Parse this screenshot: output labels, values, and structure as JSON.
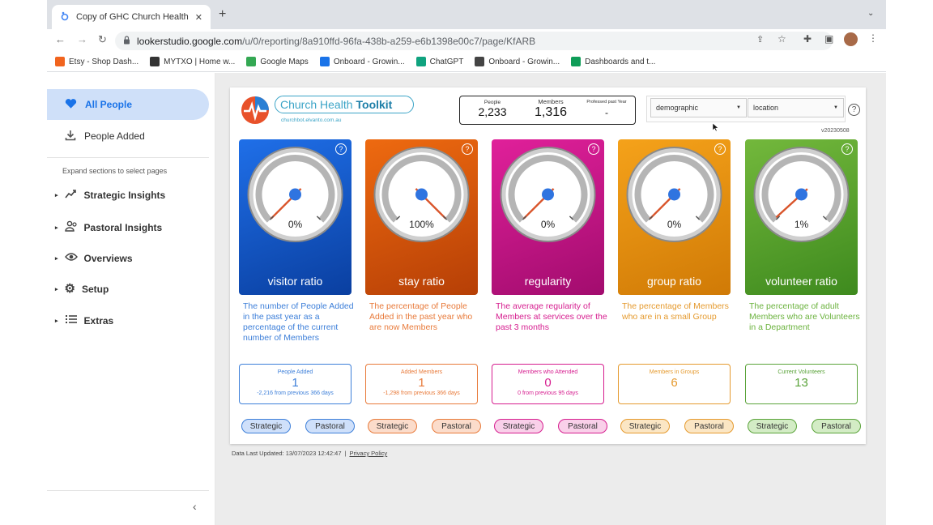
{
  "browser": {
    "tab_title": "Copy of GHC Church Health To",
    "url_host": "lookerstudio.google.com",
    "url_path": "/u/0/reporting/8a910ffd-96fa-438b-a259-e6b1398e00c7/page/KfARB",
    "bookmarks": [
      {
        "label": "Etsy - Shop Dash...",
        "color": "#f1641e"
      },
      {
        "label": "MYTXO | Home w...",
        "color": "#333333"
      },
      {
        "label": "Google Maps",
        "color": "#34a853"
      },
      {
        "label": "Onboard - Growin...",
        "color": "#1a73e8"
      },
      {
        "label": "ChatGPT",
        "color": "#10a37f"
      },
      {
        "label": "Onboard - Growin...",
        "color": "#444444"
      },
      {
        "label": "Dashboards and t...",
        "color": "#0f9d58"
      }
    ]
  },
  "sidebar": {
    "pages": [
      {
        "label": "All People",
        "icon": "heart-icon",
        "active": true
      },
      {
        "label": "People Added",
        "icon": "download-icon",
        "active": false
      }
    ],
    "hint": "Expand sections to select pages",
    "groups": [
      {
        "label": "Strategic Insights",
        "icon": "trend-icon"
      },
      {
        "label": "Pastoral Insights",
        "icon": "people-icon"
      },
      {
        "label": "Overviews",
        "icon": "eye-icon"
      },
      {
        "label": "Setup",
        "icon": "gear-icon"
      },
      {
        "label": "Extras",
        "icon": "list-icon"
      }
    ]
  },
  "header": {
    "brand_text": "Church Health",
    "brand_bold": "Toolkit",
    "brand_url": "churchbot.elvanto.com.au",
    "stats": [
      {
        "label": "People",
        "value": "2,233"
      },
      {
        "label": "Members",
        "value": "1,316"
      },
      {
        "label": "Professed past Year",
        "value": "-"
      }
    ],
    "filter_demographic": "demographic",
    "filter_location": "location",
    "version": "v20230508"
  },
  "cards": [
    {
      "label": "visitor ratio",
      "percent": "0%",
      "gauge_fraction": 0.0,
      "color_top": "#1f6fe8",
      "color_bottom": "#0a3fa0",
      "desc": "The number of People Added in the past year as a percentage of the current number of Members",
      "desc_color": "#3d7fd9",
      "metric_title": "People Added",
      "metric_value": "1",
      "metric_delta": "-2,216 from previous 366 days",
      "accent": "#3d7fd9",
      "pill_bg": "#cfe0fa"
    },
    {
      "label": "stay ratio",
      "percent": "100%",
      "gauge_fraction": 1.0,
      "color_top": "#ee6a10",
      "color_bottom": "#b63f06",
      "desc": "The percentage of People Added in the past year who are now Members",
      "desc_color": "#e87a3a",
      "metric_title": "Added Members",
      "metric_value": "1",
      "metric_delta": "-1,298 from previous 366 days",
      "accent": "#e87a3a",
      "pill_bg": "#fbdccb"
    },
    {
      "label": "regularity",
      "percent": "0%",
      "gauge_fraction": 0.0,
      "color_top": "#e0209a",
      "color_bottom": "#a20c6e",
      "desc": "The average regularity of Members at services over the past 3 months",
      "desc_color": "#d61d8f",
      "metric_title": "Members who Attended",
      "metric_value": "0",
      "metric_delta": "0 from previous 95 days",
      "accent": "#d61d8f",
      "pill_bg": "#f9d0e9"
    },
    {
      "label": "group ratio",
      "percent": "0%",
      "gauge_fraction": 0.0,
      "color_top": "#f5a21a",
      "color_bottom": "#d07a06",
      "desc": "The percentage of Members who are in a small Group",
      "desc_color": "#e59a2e",
      "metric_title": "Members in Groups",
      "metric_value": "6",
      "metric_delta": "",
      "accent": "#e59a2e",
      "pill_bg": "#fbe6c4"
    },
    {
      "label": "volunteer ratio",
      "percent": "1%",
      "gauge_fraction": 0.01,
      "color_top": "#73b83c",
      "color_bottom": "#3e8a1e",
      "desc": "The percentage of adult Members who are Volunteers in a Department",
      "desc_color": "#6cb33f",
      "metric_title": "Current Volunteers",
      "metric_value": "13",
      "metric_delta": "",
      "accent": "#5aa33a",
      "pill_bg": "#d3ecc5"
    }
  ],
  "pill_labels": {
    "strategic": "Strategic",
    "pastoral": "Pastoral"
  },
  "footer": {
    "updated": "Data Last Updated: 13/07/2023 12:42:47",
    "privacy": "Privacy Policy"
  }
}
